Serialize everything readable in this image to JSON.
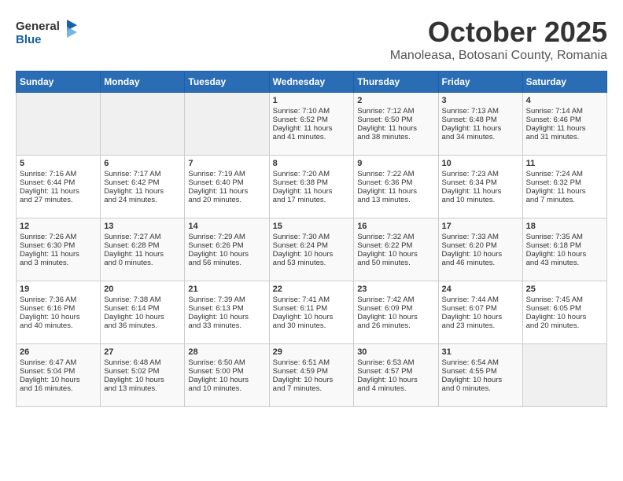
{
  "logo": {
    "text_general": "General",
    "text_blue": "Blue",
    "icon": "▶"
  },
  "title": "October 2025",
  "subtitle": "Manoleasa, Botosani County, Romania",
  "headers": [
    "Sunday",
    "Monday",
    "Tuesday",
    "Wednesday",
    "Thursday",
    "Friday",
    "Saturday"
  ],
  "weeks": [
    [
      {
        "day": "",
        "content": ""
      },
      {
        "day": "",
        "content": ""
      },
      {
        "day": "",
        "content": ""
      },
      {
        "day": "1",
        "content": "Sunrise: 7:10 AM\nSunset: 6:52 PM\nDaylight: 11 hours\nand 41 minutes."
      },
      {
        "day": "2",
        "content": "Sunrise: 7:12 AM\nSunset: 6:50 PM\nDaylight: 11 hours\nand 38 minutes."
      },
      {
        "day": "3",
        "content": "Sunrise: 7:13 AM\nSunset: 6:48 PM\nDaylight: 11 hours\nand 34 minutes."
      },
      {
        "day": "4",
        "content": "Sunrise: 7:14 AM\nSunset: 6:46 PM\nDaylight: 11 hours\nand 31 minutes."
      }
    ],
    [
      {
        "day": "5",
        "content": "Sunrise: 7:16 AM\nSunset: 6:44 PM\nDaylight: 11 hours\nand 27 minutes."
      },
      {
        "day": "6",
        "content": "Sunrise: 7:17 AM\nSunset: 6:42 PM\nDaylight: 11 hours\nand 24 minutes."
      },
      {
        "day": "7",
        "content": "Sunrise: 7:19 AM\nSunset: 6:40 PM\nDaylight: 11 hours\nand 20 minutes."
      },
      {
        "day": "8",
        "content": "Sunrise: 7:20 AM\nSunset: 6:38 PM\nDaylight: 11 hours\nand 17 minutes."
      },
      {
        "day": "9",
        "content": "Sunrise: 7:22 AM\nSunset: 6:36 PM\nDaylight: 11 hours\nand 13 minutes."
      },
      {
        "day": "10",
        "content": "Sunrise: 7:23 AM\nSunset: 6:34 PM\nDaylight: 11 hours\nand 10 minutes."
      },
      {
        "day": "11",
        "content": "Sunrise: 7:24 AM\nSunset: 6:32 PM\nDaylight: 11 hours\nand 7 minutes."
      }
    ],
    [
      {
        "day": "12",
        "content": "Sunrise: 7:26 AM\nSunset: 6:30 PM\nDaylight: 11 hours\nand 3 minutes."
      },
      {
        "day": "13",
        "content": "Sunrise: 7:27 AM\nSunset: 6:28 PM\nDaylight: 11 hours\nand 0 minutes."
      },
      {
        "day": "14",
        "content": "Sunrise: 7:29 AM\nSunset: 6:26 PM\nDaylight: 10 hours\nand 56 minutes."
      },
      {
        "day": "15",
        "content": "Sunrise: 7:30 AM\nSunset: 6:24 PM\nDaylight: 10 hours\nand 53 minutes."
      },
      {
        "day": "16",
        "content": "Sunrise: 7:32 AM\nSunset: 6:22 PM\nDaylight: 10 hours\nand 50 minutes."
      },
      {
        "day": "17",
        "content": "Sunrise: 7:33 AM\nSunset: 6:20 PM\nDaylight: 10 hours\nand 46 minutes."
      },
      {
        "day": "18",
        "content": "Sunrise: 7:35 AM\nSunset: 6:18 PM\nDaylight: 10 hours\nand 43 minutes."
      }
    ],
    [
      {
        "day": "19",
        "content": "Sunrise: 7:36 AM\nSunset: 6:16 PM\nDaylight: 10 hours\nand 40 minutes."
      },
      {
        "day": "20",
        "content": "Sunrise: 7:38 AM\nSunset: 6:14 PM\nDaylight: 10 hours\nand 36 minutes."
      },
      {
        "day": "21",
        "content": "Sunrise: 7:39 AM\nSunset: 6:13 PM\nDaylight: 10 hours\nand 33 minutes."
      },
      {
        "day": "22",
        "content": "Sunrise: 7:41 AM\nSunset: 6:11 PM\nDaylight: 10 hours\nand 30 minutes."
      },
      {
        "day": "23",
        "content": "Sunrise: 7:42 AM\nSunset: 6:09 PM\nDaylight: 10 hours\nand 26 minutes."
      },
      {
        "day": "24",
        "content": "Sunrise: 7:44 AM\nSunset: 6:07 PM\nDaylight: 10 hours\nand 23 minutes."
      },
      {
        "day": "25",
        "content": "Sunrise: 7:45 AM\nSunset: 6:05 PM\nDaylight: 10 hours\nand 20 minutes."
      }
    ],
    [
      {
        "day": "26",
        "content": "Sunrise: 6:47 AM\nSunset: 5:04 PM\nDaylight: 10 hours\nand 16 minutes."
      },
      {
        "day": "27",
        "content": "Sunrise: 6:48 AM\nSunset: 5:02 PM\nDaylight: 10 hours\nand 13 minutes."
      },
      {
        "day": "28",
        "content": "Sunrise: 6:50 AM\nSunset: 5:00 PM\nDaylight: 10 hours\nand 10 minutes."
      },
      {
        "day": "29",
        "content": "Sunrise: 6:51 AM\nSunset: 4:59 PM\nDaylight: 10 hours\nand 7 minutes."
      },
      {
        "day": "30",
        "content": "Sunrise: 6:53 AM\nSunset: 4:57 PM\nDaylight: 10 hours\nand 4 minutes."
      },
      {
        "day": "31",
        "content": "Sunrise: 6:54 AM\nSunset: 4:55 PM\nDaylight: 10 hours\nand 0 minutes."
      },
      {
        "day": "",
        "content": ""
      }
    ]
  ]
}
